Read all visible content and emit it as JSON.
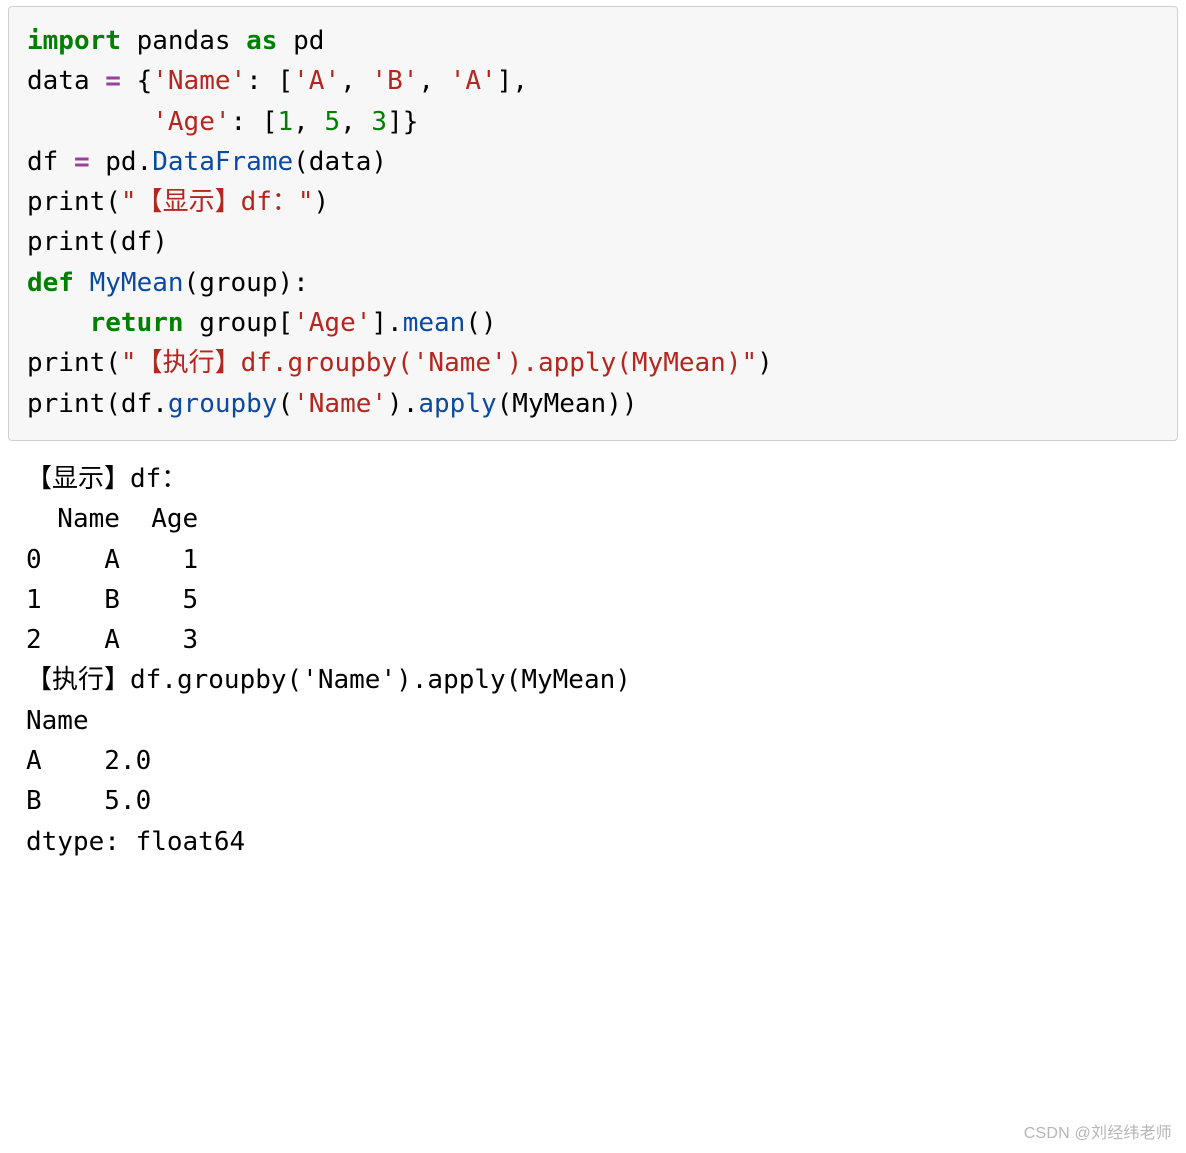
{
  "code": {
    "l1": {
      "import": "import",
      "pandas": " pandas ",
      "as": "as",
      "pd": " pd"
    },
    "l2_a": "data ",
    "l2_eq": "=",
    "l2_b": " {",
    "l2_s1": "'Name'",
    "l2_c": ": [",
    "l2_s2": "'A'",
    "l2_d": ", ",
    "l2_s3": "'B'",
    "l2_e": ", ",
    "l2_s4": "'A'",
    "l2_f": "],",
    "l3_a": "        ",
    "l3_s1": "'Age'",
    "l3_b": ": [",
    "l3_n1": "1",
    "l3_c": ", ",
    "l3_n2": "5",
    "l3_d": ", ",
    "l3_n3": "3",
    "l3_e": "]}",
    "l4_a": "df ",
    "l4_eq": "=",
    "l4_b": " pd.",
    "l4_fn": "DataFrame",
    "l4_c": "(data)",
    "l5_a": "print(",
    "l5_s": "\"【显示】df：\"",
    "l5_b": ")",
    "l6": "print(df)",
    "l7_a": "def",
    "l7_b": " ",
    "l7_fn": "MyMean",
    "l7_c": "(group):",
    "l8_a": "    ",
    "l8_ret": "return",
    "l8_b": " group[",
    "l8_s": "'Age'",
    "l8_c": "].",
    "l8_fn": "mean",
    "l8_d": "()",
    "l9_a": "print(",
    "l9_s": "\"【执行】df.groupby('Name').apply(MyMean)\"",
    "l9_b": ")",
    "l10_a": "print(df.",
    "l10_fn1": "groupby",
    "l10_b": "(",
    "l10_s": "'Name'",
    "l10_c": ").",
    "l10_fn2": "apply",
    "l10_d": "(MyMean))"
  },
  "output": {
    "line1": "【显示】df：",
    "line2": "  Name  Age",
    "line3": "0    A    1",
    "line4": "1    B    5",
    "line5": "2    A    3",
    "line6": "【执行】df.groupby('Name').apply(MyMean)",
    "line7": "Name",
    "line8": "A    2.0",
    "line9": "B    5.0",
    "line10": "dtype: float64"
  },
  "watermark": "CSDN @刘经纬老师"
}
